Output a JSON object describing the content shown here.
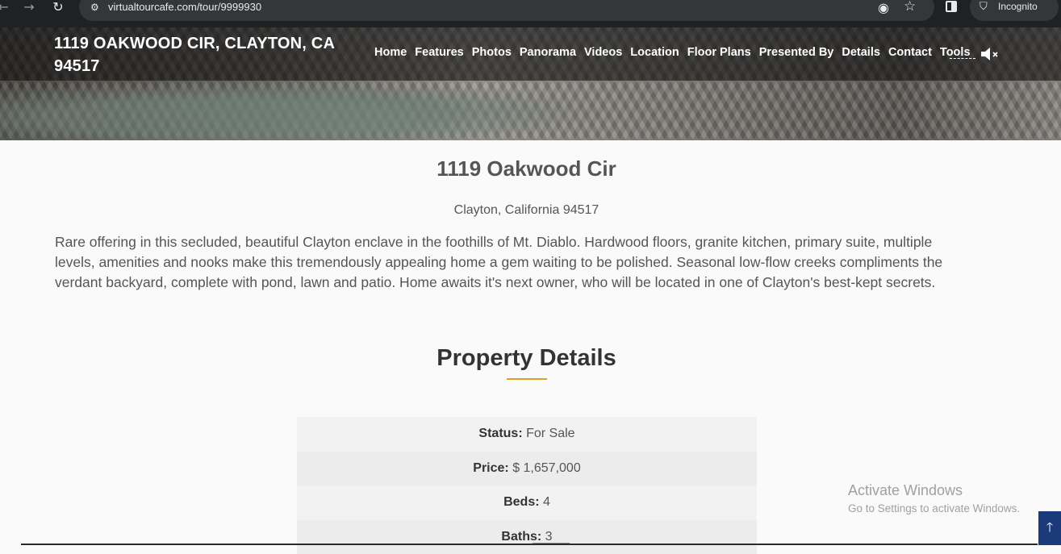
{
  "browser": {
    "url": "virtualtourcafe.com/tour/9999930",
    "incognito_label": "Incognito"
  },
  "header": {
    "site_title": "1119 OAKWOOD CIR, CLAYTON, CA 94517",
    "nav": [
      "Home",
      "Features",
      "Photos",
      "Panorama",
      "Videos",
      "Location",
      "Floor Plans",
      "Presented By",
      "Details",
      "Contact",
      "Tools"
    ]
  },
  "property": {
    "title": "1119 Oakwood Cir",
    "city": "Clayton, California 94517",
    "description": "Rare offering in this secluded, beautiful Clayton enclave in the foothills of Mt. Diablo. Hardwood floors, granite kitchen, primary suite, multiple levels, amenities and nooks make this tremendously appealing home a gem waiting to be polished. Seasonal low-flow creeks compliments the verdant backyard, complete with pond, lawn and patio. Home awaits it's next owner, who will be located in one of Clayton's best-kept secrets."
  },
  "details": {
    "heading": "Property Details",
    "rows": [
      {
        "label": "Status:",
        "value": "For Sale"
      },
      {
        "label": "Price:",
        "value": "$ 1,657,000"
      },
      {
        "label": "Beds:",
        "value": "4"
      },
      {
        "label": "Baths:",
        "value": "3"
      }
    ]
  },
  "watermark": {
    "title": "Activate Windows",
    "subtitle": "Go to Settings to activate Windows."
  },
  "colors": {
    "accent_underline": "#e0a020",
    "scroll_top_bg": "#1a3a7a"
  }
}
